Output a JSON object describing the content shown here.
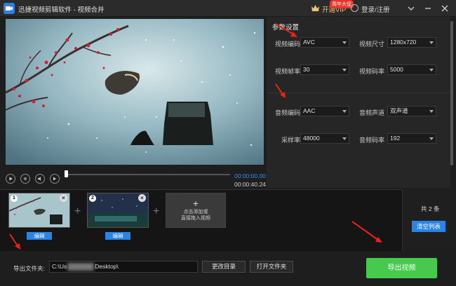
{
  "titlebar": {
    "title": "迅捷视频剪辑软件 - 视频合并",
    "vip_label": "开通VIP",
    "vip_badge": "周年大促",
    "login_label": "登录/注册",
    "window_buttons": [
      "dropdown-icon",
      "minimize-icon",
      "close-icon"
    ]
  },
  "player": {
    "time_current": "00:00:00.00",
    "time_total": "00:00:40.24",
    "progress": 0.0,
    "buttons": [
      "play-icon",
      "stop-icon",
      "volume-icon",
      "loop-icon"
    ]
  },
  "settings": {
    "title": "参数设置",
    "video_codec_label": "视频编码",
    "video_codec": "AVC",
    "video_size_label": "视频尺寸",
    "video_size": "1280x720",
    "frame_rate_label": "视频帧率",
    "frame_rate": "30",
    "video_bitrate_label": "视频码率",
    "video_bitrate": "5000",
    "audio_codec_label": "音频编码",
    "audio_codec": "AAC",
    "audio_channel_label": "音频声道",
    "audio_channel": "双声道",
    "sample_rate_label": "采样率",
    "sample_rate": "48000",
    "audio_bitrate_label": "音频码率",
    "audio_bitrate": "192"
  },
  "clips": [
    {
      "number": "1",
      "edit_label": "编辑"
    },
    {
      "number": "2",
      "edit_label": "编辑"
    }
  ],
  "add_tile": {
    "line1": "点击添加或",
    "line2": "直接拖入视频"
  },
  "clip_count": "共 2 条",
  "clear_label": "清空列表",
  "bottom": {
    "export_folder_label": "导出文件夹:",
    "path_prefix": "C:\\Us",
    "path_suffix": "Desktop\\",
    "change_dir_label": "更改目录",
    "open_folder_label": "打开文件夹",
    "export_label": "导出视频"
  },
  "colors": {
    "accent_blue": "#2a84e6",
    "export_green": "#47c94d",
    "annotation_red": "#e8231a"
  }
}
